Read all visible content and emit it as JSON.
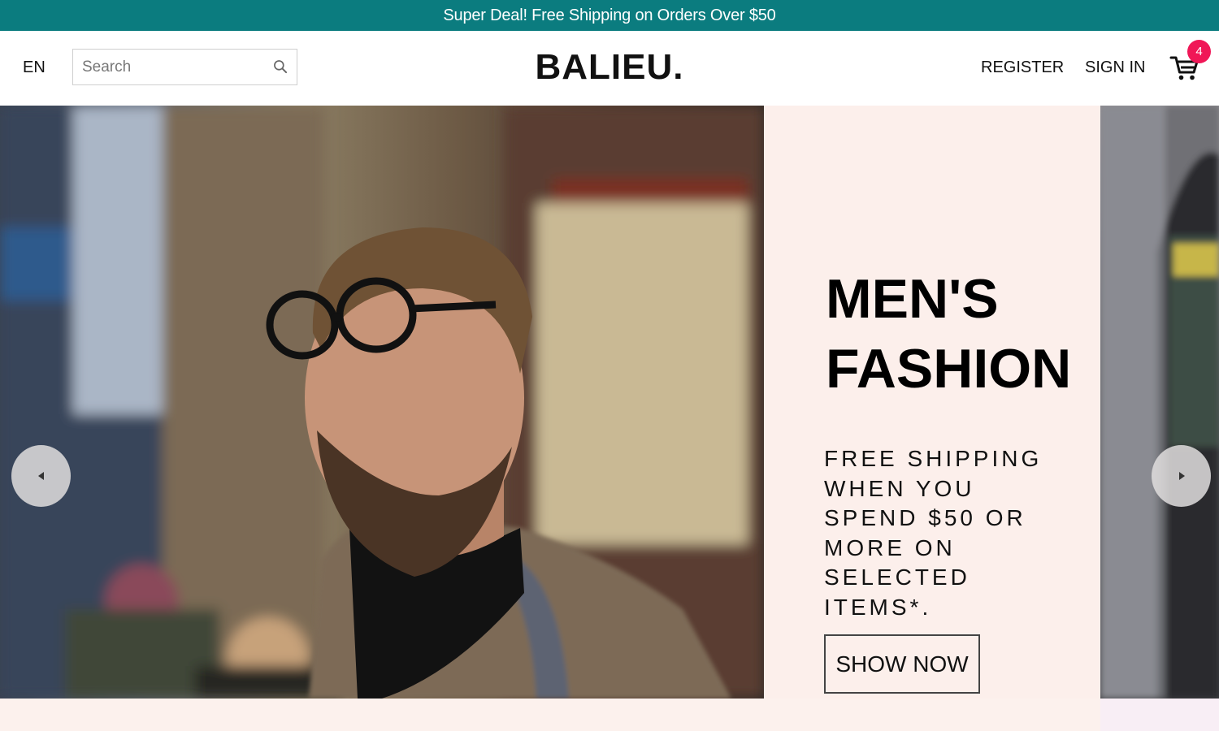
{
  "announcement": {
    "text": "Super Deal! Free Shipping on Orders Over $50"
  },
  "header": {
    "language": "EN",
    "search": {
      "placeholder": "Search",
      "value": ""
    },
    "logo": "BALIEU.",
    "register_label": "REGISTER",
    "signin_label": "SIGN IN",
    "cart": {
      "icon": "cart-icon",
      "badge_count": "4"
    }
  },
  "hero": {
    "title_line1": "MEN'S",
    "title_line2": "FASHION",
    "description": "FREE SHIPPING WHEN YOU SPEND $50 OR MORE ON SELECTED ITEMS*.",
    "cta_label": "SHOW NOW",
    "panel_color": "#fcefeb",
    "prev_icon": "chevron-left-icon",
    "next_icon": "chevron-right-icon"
  },
  "colors": {
    "announcement_bg": "#0b7c7f",
    "badge": "#f01757",
    "page_bg": "#fcf1ed"
  }
}
